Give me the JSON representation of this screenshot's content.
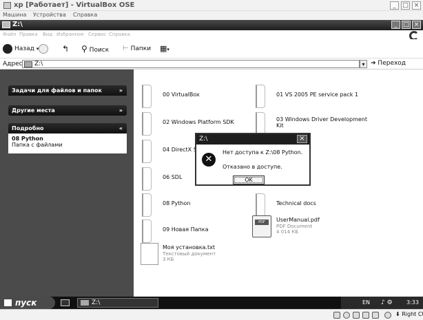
{
  "vbox": {
    "title": "xp [Работает] - VirtualBox OSE",
    "menu": [
      "Машина",
      "Устройства",
      "Справка"
    ],
    "controls": [
      "_",
      "□",
      "×"
    ]
  },
  "window": {
    "title": "Z:\\",
    "controls": [
      "_",
      "□",
      "×"
    ],
    "menu": [
      "Файл",
      "Правка",
      "Вид",
      "Избранное",
      "Сервис",
      "Справка"
    ]
  },
  "toolbar": {
    "back": "Назад",
    "search": "Поиск",
    "folders": "Папки"
  },
  "address": {
    "label": "Адрес:",
    "value": "Z:\\",
    "go": "Переход"
  },
  "sidebar": {
    "tasks": "Задачи для файлов и папок",
    "places": "Другие места",
    "details": "Подробно",
    "details_name": "08 Python",
    "details_type": "Папка с файлами"
  },
  "files": [
    {
      "name": "00 VirtualBox"
    },
    {
      "name": "01 VS 2005 PE service pack 1"
    },
    {
      "name": "02 Windows Platform SDK"
    },
    {
      "name": "03 Windows Driver Development Kit"
    },
    {
      "name": "04 DirectX S"
    },
    {
      "name": "06 SDL"
    },
    {
      "name": "08 Python"
    },
    {
      "name": "Technical docs"
    },
    {
      "name": "09 Новая Папка"
    },
    {
      "name": "UserManual.pdf",
      "type": "PDF Document",
      "size": "4 014 КБ"
    },
    {
      "name": "Моя установка.txt",
      "type": "Текстовый документ",
      "size": "3 КБ"
    }
  ],
  "dialog": {
    "title": "Z:\\",
    "message": "Нет доступа к Z:\\08 Python.",
    "detail": "Отказано в доступе.",
    "ok": "OK"
  },
  "taskbar": {
    "start": "пуск",
    "task": "Z:\\",
    "lang": "EN",
    "time": "3:33"
  },
  "statusbar": {
    "host_key": "Right Ctrl"
  }
}
